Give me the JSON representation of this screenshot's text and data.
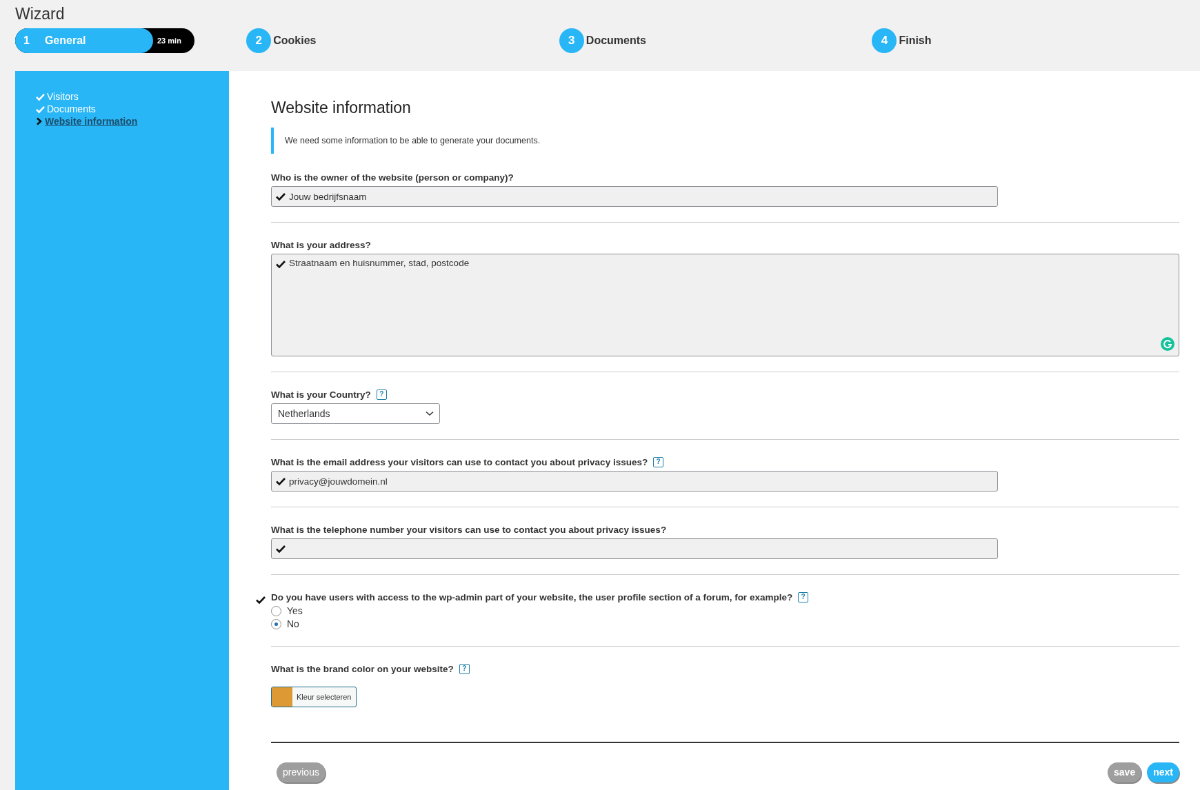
{
  "window": {
    "title": "Wizard"
  },
  "steps": [
    {
      "number": "1",
      "label": "General",
      "time": "23 min",
      "selected": true
    },
    {
      "number": "2",
      "label": "Cookies",
      "selected": false
    },
    {
      "number": "3",
      "label": "Documents",
      "selected": false
    },
    {
      "number": "4",
      "label": "Finish",
      "selected": false
    }
  ],
  "sidebar": {
    "items": [
      {
        "label": "Visitors",
        "done": true
      },
      {
        "label": "Documents",
        "done": true
      },
      {
        "label": "Website information",
        "done": false
      }
    ]
  },
  "section": {
    "title": "Website information",
    "intro": "We need some information to be able to generate your documents."
  },
  "fields": [
    {
      "kind": "text",
      "label": "Who is the owner of the website (person or company)?",
      "value": "Jouw bedrijfsnaam",
      "valid": true,
      "help": false
    },
    {
      "kind": "textarea",
      "label": "What is your address?",
      "value": "Straatnaam en huisnummer, stad, postcode",
      "valid": true,
      "help": false
    },
    {
      "kind": "select",
      "label": "What is your Country?",
      "value": "Netherlands",
      "help": true,
      "help_label": "?"
    },
    {
      "kind": "text",
      "label": "What is the email address your visitors can use to contact you about privacy issues?",
      "value": "privacy@jouwdomein.nl",
      "valid": true,
      "help": true,
      "help_label": "?"
    },
    {
      "kind": "text",
      "label": "What is the telephone number your visitors can use to contact you about privacy issues?",
      "valid": true,
      "help": false
    },
    {
      "kind": "radio",
      "label": "Do you have users with access to the wp-admin part of your website, the user profile section of a forum, for example?",
      "valid": true,
      "help": true,
      "help_label": "?",
      "options": [
        {
          "label": "Yes",
          "selected": false
        },
        {
          "label": "No",
          "selected": true
        }
      ]
    },
    {
      "kind": "color",
      "label": "What is the brand color on your website?",
      "help": true,
      "help_label": "?",
      "color": "#dd9933",
      "button": "Kleur selecteren"
    }
  ],
  "buttons": [
    {
      "label": "previous",
      "disabled": true
    },
    {
      "label": "save",
      "disabled": true
    },
    {
      "label": "next",
      "disabled": false
    }
  ]
}
